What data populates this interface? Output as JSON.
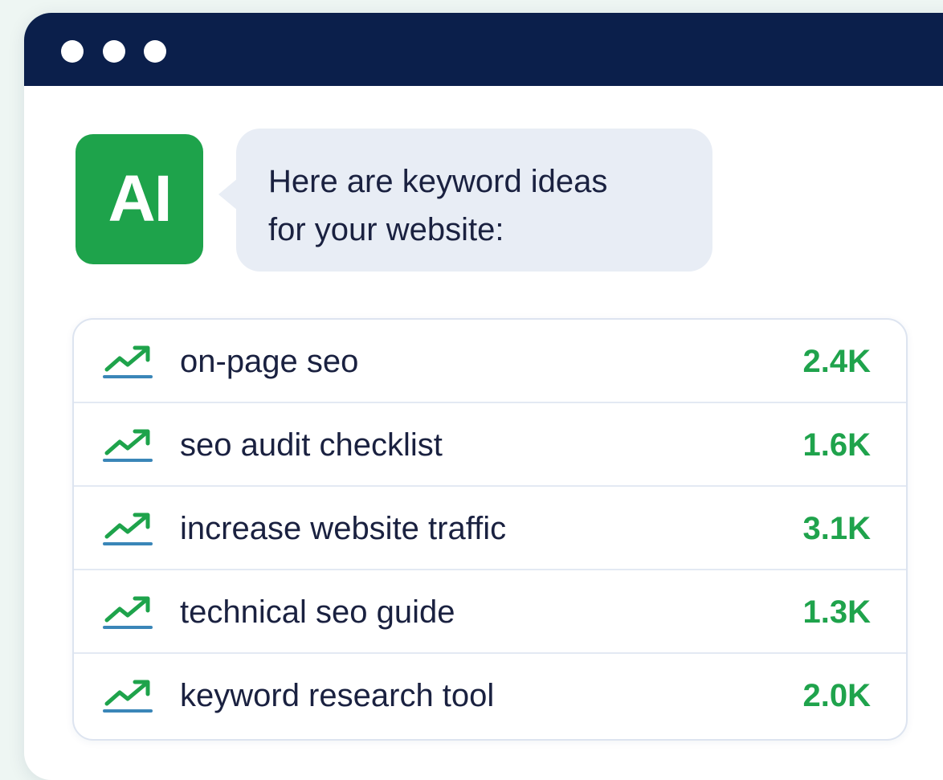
{
  "window": {
    "title_dots": [
      "dot-1",
      "dot-2",
      "dot-3"
    ]
  },
  "chat": {
    "avatar_label": "AI",
    "message": "Here are keyword ideas\nfor your website:"
  },
  "keywords": [
    {
      "keyword": "on-page seo",
      "volume": "2.4K",
      "icon": "trending-up-icon"
    },
    {
      "keyword": "seo audit checklist",
      "volume": "1.6K",
      "icon": "trending-up-icon"
    },
    {
      "keyword": "increase website traffic",
      "volume": "3.1K",
      "icon": "trending-up-icon"
    },
    {
      "keyword": "technical seo guide",
      "volume": "1.3K",
      "icon": "trending-up-icon"
    },
    {
      "keyword": "keyword research tool",
      "volume": "2.0K",
      "icon": "trending-up-icon"
    }
  ],
  "colors": {
    "titlebar": "#0b1f4b",
    "accent_green": "#1ea34b",
    "trend_blue": "#3a86b8"
  }
}
